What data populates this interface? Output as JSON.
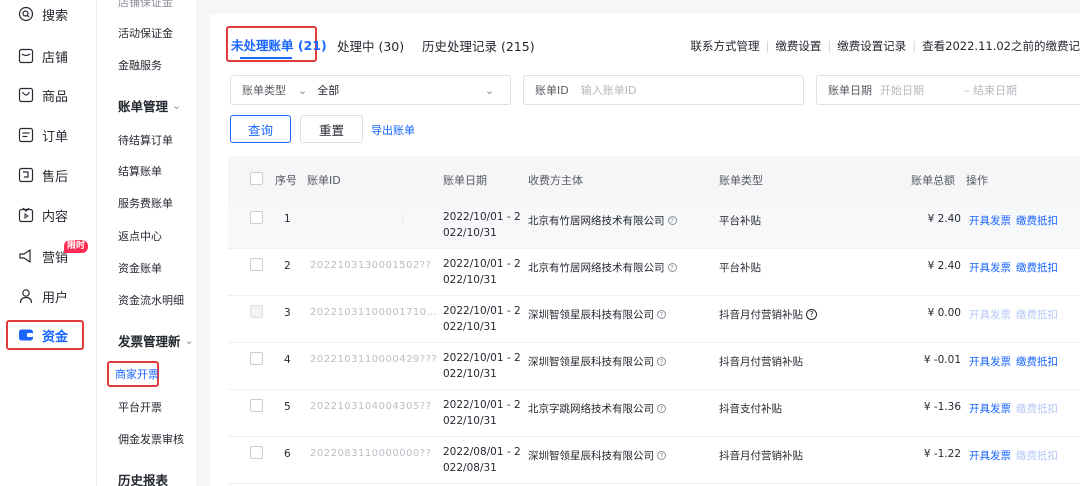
{
  "rail": {
    "items": [
      {
        "label": "搜索",
        "icon": "search-icon"
      },
      {
        "label": "店铺",
        "icon": "shop-icon"
      },
      {
        "label": "商品",
        "icon": "product-icon"
      },
      {
        "label": "订单",
        "icon": "order-icon"
      },
      {
        "label": "售后",
        "icon": "aftersale-icon"
      },
      {
        "label": "内容",
        "icon": "content-icon"
      },
      {
        "label": "营销",
        "icon": "marketing-icon"
      },
      {
        "label": "用户",
        "icon": "user-icon"
      },
      {
        "label": "资金",
        "icon": "funds-icon"
      }
    ],
    "new_badge": "限时"
  },
  "subnav": {
    "top_cut": "店铺保证金",
    "items_a": [
      "活动保证金",
      "金融服务"
    ],
    "group_bill": "账单管理",
    "items_b": [
      "待结算订单",
      "结算账单",
      "服务费账单",
      "返点中心",
      "资金账单",
      "资金流水明细"
    ],
    "group_invoice": "发票管理新",
    "active_item": "商家开票",
    "items_c": [
      "平台开票",
      "佣金发票审核"
    ],
    "group_history": "历史报表"
  },
  "tabs": {
    "active": "未处理账单 (21)",
    "processing": "处理中 (30)",
    "history": "历史处理记录 (215)"
  },
  "toplinks": [
    "联系方式管理",
    "缴费设置",
    "缴费设置记录",
    "查看2022.11.02之前的缴费记"
  ],
  "filters": {
    "type_label": "账单类型",
    "type_value": "全部",
    "id_label": "账单ID",
    "id_placeholder": "输入账单ID",
    "date_label": "账单日期",
    "date_start_placeholder": "开始日期",
    "date_end_placeholder": "– 结束日期"
  },
  "buttons": {
    "query": "查询",
    "reset": "重置",
    "export": "导出账单"
  },
  "table": {
    "headers": {
      "index": "序号",
      "bill_id": "账单ID",
      "date": "账单日期",
      "payee": "收费方主体",
      "type": "账单类型",
      "total": "账单总额",
      "ops": "操作"
    },
    "rows": [
      {
        "index": "1",
        "bill_id": ")",
        "date1": "2022/10/01 - 2",
        "date2": "022/10/31",
        "payee": "北京有竹居网络技术有限公司",
        "type": "平台补贴",
        "type_info": false,
        "amount": "¥ 2.40",
        "op1": "开具发票",
        "op2": "缴费抵扣",
        "op_disabled": false
      },
      {
        "index": "2",
        "bill_id": "2022103130001502??",
        "date1": "2022/10/01 - 2",
        "date2": "022/10/31",
        "payee": "北京有竹居网络技术有限公司",
        "type": "平台补贴",
        "type_info": false,
        "amount": "¥ 2.40",
        "op1": "开具发票",
        "op2": "缴费抵扣",
        "op_disabled": false
      },
      {
        "index": "3",
        "bill_id": "20221031100001710…",
        "date1": "2022/10/01 - 2",
        "date2": "022/10/31",
        "payee": "深圳智领星辰科技有限公司",
        "type": "抖音月付营销补贴",
        "type_info": true,
        "amount": "¥ 0.00",
        "op1": "开具发票",
        "op2": "缴费抵扣",
        "op_disabled": true
      },
      {
        "index": "4",
        "bill_id": "2022103110000429???",
        "date1": "2022/10/01 - 2",
        "date2": "022/10/31",
        "payee": "深圳智领星辰科技有限公司",
        "type": "抖音月付营销补贴",
        "type_info": false,
        "amount": "¥ -0.01",
        "op1": "开具发票",
        "op2": "缴费抵扣",
        "op_disabled": false
      },
      {
        "index": "5",
        "bill_id": "2022103104004305??",
        "date1": "2022/10/01 - 2",
        "date2": "022/10/31",
        "payee": "北京字跳网络技术有限公司",
        "type": "抖音支付补贴",
        "type_info": false,
        "amount": "¥ -1.36",
        "op1": "开具发票",
        "op2": "缴费抵扣",
        "op_disabled": false,
        "op2_disabled": true
      },
      {
        "index": "6",
        "bill_id": "2022083110000000??",
        "date1": "2022/08/01 - 2",
        "date2": "022/08/31",
        "payee": "深圳智领星辰科技有限公司",
        "type": "抖音月付营销补贴",
        "type_info": false,
        "amount": "¥ -1.22",
        "op1": "开具发票",
        "op2": "缴费抵扣",
        "op_disabled": false,
        "op2_disabled": true
      }
    ]
  },
  "colors": {
    "accent": "#1966ff",
    "highlight": "#e03a3a",
    "badge": "#fe2c55"
  }
}
